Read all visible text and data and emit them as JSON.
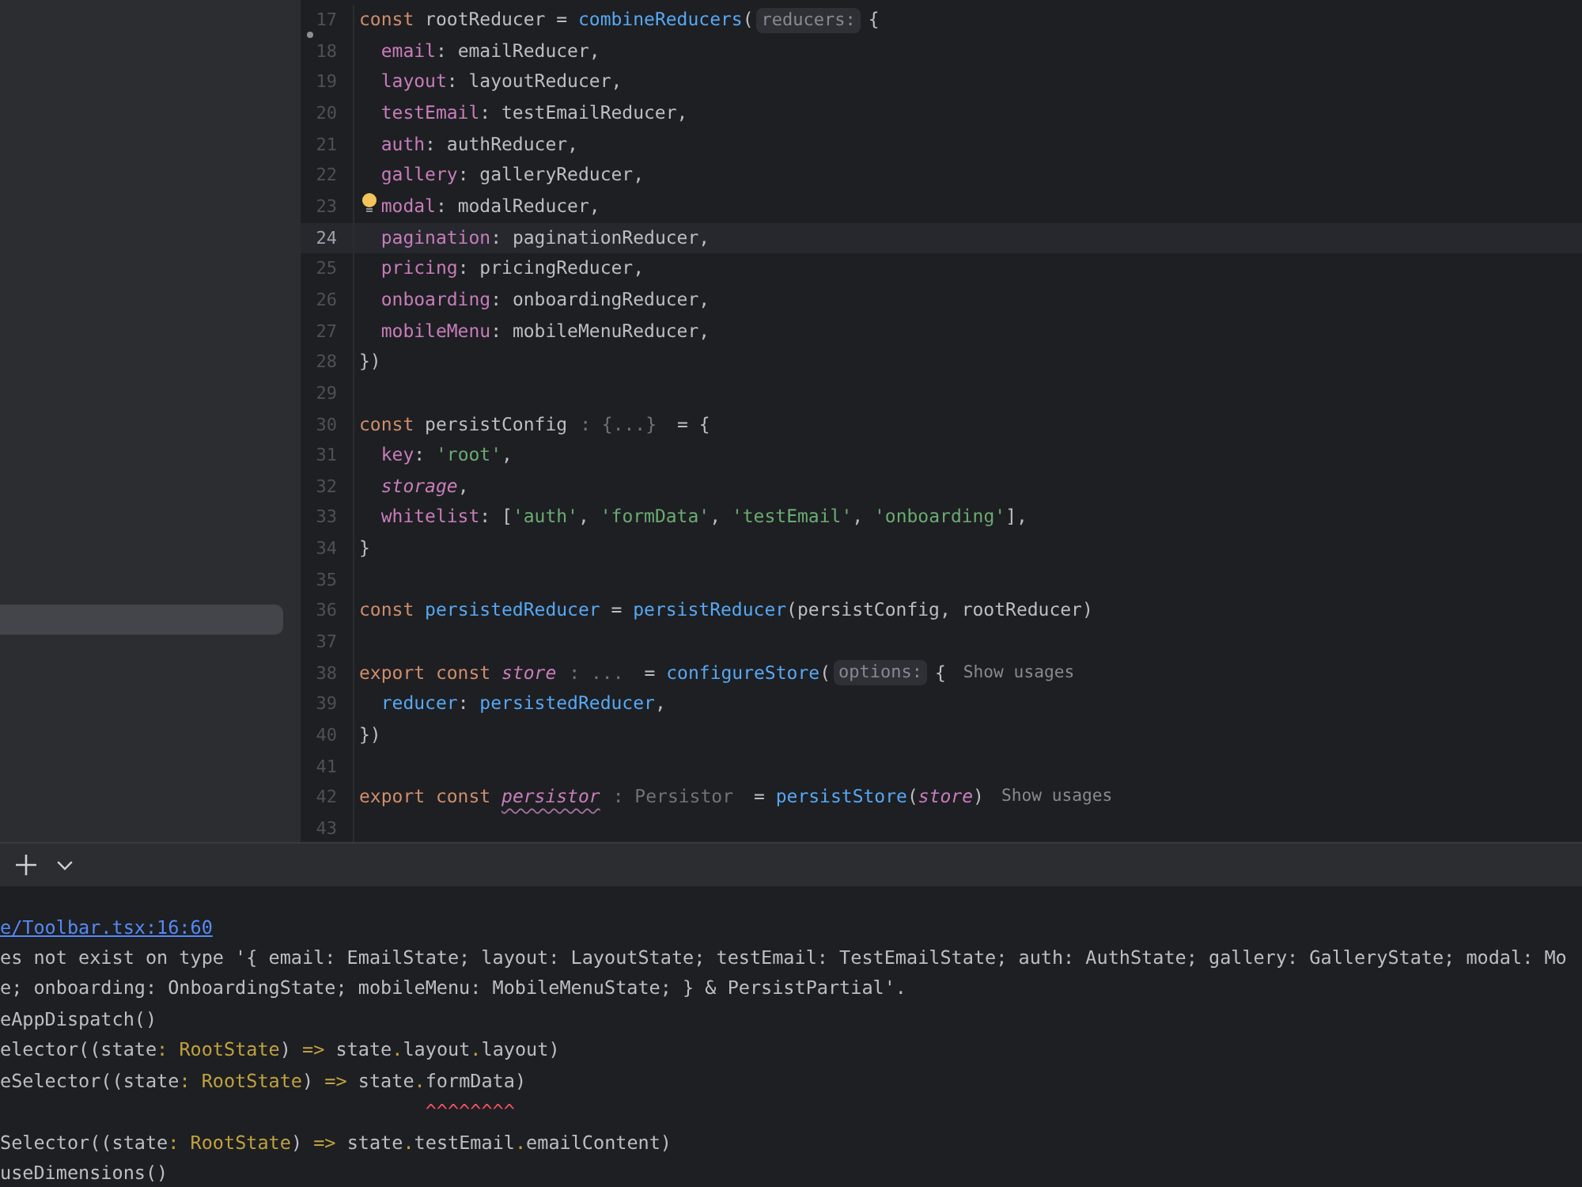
{
  "sidebar": {
    "rows": [
      {
        "selected": true
      }
    ]
  },
  "editor": {
    "lines": [
      {
        "number": "17",
        "current": false,
        "marked": true,
        "quick_fix": false,
        "tokens": [
          {
            "kind": "keyword",
            "text": "const"
          },
          {
            "kind": "text",
            "text": " rootReducer = "
          },
          {
            "kind": "call",
            "text": "combineReducers"
          },
          {
            "kind": "text",
            "text": "("
          },
          {
            "kind": "hint",
            "text": "reducers:"
          },
          {
            "kind": "text",
            "text": "{"
          }
        ],
        "children": [
          {
            "number": "18",
            "current": false,
            "marked": false,
            "quick_fix": false,
            "tokens": [
              {
                "kind": "property",
                "text": "email"
              },
              {
                "kind": "text",
                "text": ": emailReducer,"
              }
            ]
          },
          {
            "number": "19",
            "current": false,
            "marked": false,
            "quick_fix": false,
            "tokens": [
              {
                "kind": "property",
                "text": "layout"
              },
              {
                "kind": "text",
                "text": ": layoutReducer,"
              }
            ]
          },
          {
            "number": "20",
            "current": false,
            "marked": false,
            "quick_fix": false,
            "tokens": [
              {
                "kind": "property",
                "text": "testEmail"
              },
              {
                "kind": "text",
                "text": ": testEmailReducer,"
              }
            ]
          },
          {
            "number": "21",
            "current": false,
            "marked": false,
            "quick_fix": false,
            "tokens": [
              {
                "kind": "property",
                "text": "auth"
              },
              {
                "kind": "text",
                "text": ": authReducer,"
              }
            ]
          },
          {
            "number": "22",
            "current": false,
            "marked": false,
            "quick_fix": false,
            "tokens": [
              {
                "kind": "property",
                "text": "gallery"
              },
              {
                "kind": "text",
                "text": ": galleryReducer,"
              }
            ]
          },
          {
            "number": "23",
            "current": false,
            "marked": false,
            "quick_fix": true,
            "tokens": [
              {
                "kind": "property",
                "text": "modal"
              },
              {
                "kind": "text",
                "text": ": modalReducer,"
              }
            ]
          },
          {
            "number": "24",
            "current": true,
            "marked": false,
            "quick_fix": false,
            "tokens": [
              {
                "kind": "property",
                "text": "pagination"
              },
              {
                "kind": "text",
                "text": ": paginationReducer,"
              }
            ]
          },
          {
            "number": "25",
            "current": false,
            "marked": false,
            "quick_fix": false,
            "tokens": [
              {
                "kind": "property",
                "text": "pricing"
              },
              {
                "kind": "text",
                "text": ": pricingReducer,"
              }
            ]
          },
          {
            "number": "26",
            "current": false,
            "marked": false,
            "quick_fix": false,
            "tokens": [
              {
                "kind": "property",
                "text": "onboarding"
              },
              {
                "kind": "text",
                "text": ": onboardingReducer,"
              }
            ]
          },
          {
            "number": "27",
            "current": false,
            "marked": false,
            "quick_fix": false,
            "tokens": [
              {
                "kind": "property",
                "text": "mobileMenu"
              },
              {
                "kind": "text",
                "text": ": mobileMenuReducer,"
              }
            ]
          }
        ]
      },
      {
        "number": "28",
        "current": false,
        "marked": false,
        "quick_fix": false,
        "tokens": [
          {
            "kind": "text",
            "text": "})"
          }
        ]
      },
      {
        "number": "29",
        "current": false,
        "marked": false,
        "quick_fix": false
      },
      {
        "number": "30",
        "current": false,
        "marked": false,
        "quick_fix": false,
        "tokens": [
          {
            "kind": "keyword",
            "text": "const"
          },
          {
            "kind": "text",
            "text": " persistConfig"
          },
          {
            "kind": "type_hint",
            "text": ": {...}"
          },
          {
            "kind": "text",
            "text": "= {"
          }
        ],
        "children": [
          {
            "number": "31",
            "current": false,
            "marked": false,
            "quick_fix": false,
            "tokens": [
              {
                "kind": "property",
                "text": "key"
              },
              {
                "kind": "text",
                "text": ": "
              },
              {
                "kind": "string",
                "text": "'root'"
              },
              {
                "kind": "text",
                "text": ","
              }
            ]
          },
          {
            "number": "32",
            "current": false,
            "marked": false,
            "quick_fix": false,
            "tokens": [
              {
                "kind": "local",
                "text": "storage"
              },
              {
                "kind": "text",
                "text": ","
              }
            ]
          },
          {
            "number": "33",
            "current": false,
            "marked": false,
            "quick_fix": false,
            "tokens": [
              {
                "kind": "property",
                "text": "whitelist"
              },
              {
                "kind": "text",
                "text": ": ["
              },
              {
                "kind": "string",
                "text": "'auth'"
              },
              {
                "kind": "text",
                "text": ", "
              },
              {
                "kind": "string",
                "text": "'formData'"
              },
              {
                "kind": "text",
                "text": ", "
              },
              {
                "kind": "string",
                "text": "'testEmail'"
              },
              {
                "kind": "text",
                "text": ", "
              },
              {
                "kind": "string",
                "text": "'onboarding'"
              },
              {
                "kind": "text",
                "text": "],"
              }
            ]
          }
        ]
      },
      {
        "number": "34",
        "current": false,
        "marked": false,
        "quick_fix": false,
        "tokens": [
          {
            "kind": "text",
            "text": "}"
          }
        ]
      },
      {
        "number": "35",
        "current": false,
        "marked": false,
        "quick_fix": false
      },
      {
        "number": "36",
        "current": false,
        "marked": false,
        "quick_fix": false,
        "tokens": [
          {
            "kind": "keyword",
            "text": "const "
          },
          {
            "kind": "call",
            "text": "persistedReducer"
          },
          {
            "kind": "text",
            "text": " = "
          },
          {
            "kind": "call",
            "text": "persistReducer"
          },
          {
            "kind": "text",
            "text": "(persistConfig, rootReducer)"
          }
        ]
      },
      {
        "number": "37",
        "current": false,
        "marked": false,
        "quick_fix": false
      },
      {
        "number": "38",
        "current": false,
        "marked": false,
        "quick_fix": false,
        "tokens": [
          {
            "kind": "keyword",
            "text": "export const "
          },
          {
            "kind": "local",
            "text": "store"
          },
          {
            "kind": "type_hint",
            "text": ": ..."
          },
          {
            "kind": "text",
            "text": "= "
          },
          {
            "kind": "call",
            "text": "configureStore"
          },
          {
            "kind": "text",
            "text": "("
          },
          {
            "kind": "hint",
            "text": "options:"
          },
          {
            "kind": "text",
            "text": "{"
          },
          {
            "kind": "usages",
            "text": "Show usages"
          }
        ],
        "children": [
          {
            "number": "39",
            "current": false,
            "marked": false,
            "quick_fix": false,
            "tokens": [
              {
                "kind": "call",
                "text": "reducer"
              },
              {
                "kind": "text",
                "text": ": "
              },
              {
                "kind": "call",
                "text": "persistedReducer"
              },
              {
                "kind": "text",
                "text": ","
              }
            ]
          }
        ]
      },
      {
        "number": "40",
        "current": false,
        "marked": false,
        "quick_fix": false,
        "tokens": [
          {
            "kind": "text",
            "text": "})"
          }
        ]
      },
      {
        "number": "41",
        "current": false,
        "marked": false,
        "quick_fix": false
      },
      {
        "number": "42",
        "current": false,
        "marked": false,
        "quick_fix": false,
        "tokens": [
          {
            "kind": "keyword",
            "text": "export const "
          },
          {
            "kind": "local_flagged",
            "text": "persistor"
          },
          {
            "kind": "type_hint",
            "text": ": Persistor"
          },
          {
            "kind": "text",
            "text": "= "
          },
          {
            "kind": "call",
            "text": "persistStore"
          },
          {
            "kind": "text",
            "text": "("
          },
          {
            "kind": "local",
            "text": "store"
          },
          {
            "kind": "text",
            "text": ")"
          },
          {
            "kind": "usages",
            "text": "Show usages"
          }
        ]
      },
      {
        "number": "43",
        "current": false,
        "marked": false,
        "quick_fix": false
      }
    ]
  },
  "terminal": {
    "lines": [
      {
        "kind": "link",
        "text": "e/Toolbar.tsx:16:60"
      },
      {
        "kind": "output",
        "segments": [
          {
            "kind": "plain",
            "text": "es not exist on type '{ email: EmailState; layout: LayoutState; testEmail: TestEmailState; auth: AuthState; gallery: GalleryState; modal: Mo"
          }
        ]
      },
      {
        "kind": "output",
        "segments": [
          {
            "kind": "plain",
            "text": "e; onboarding: OnboardingState; mobileMenu: MobileMenuState; } & PersistPartial'."
          }
        ]
      },
      {
        "kind": "output",
        "segments": [
          {
            "kind": "plain",
            "text": "eAppDispatch()"
          }
        ]
      },
      {
        "kind": "output",
        "segments": [
          {
            "kind": "plain",
            "text": "elector((state"
          },
          {
            "kind": "type",
            "text": ": RootState"
          },
          {
            "kind": "plain",
            "text": ") "
          },
          {
            "kind": "type",
            "text": "=>"
          },
          {
            "kind": "plain",
            "text": " state"
          },
          {
            "kind": "type",
            "text": "."
          },
          {
            "kind": "plain",
            "text": "layout"
          },
          {
            "kind": "type",
            "text": "."
          },
          {
            "kind": "plain",
            "text": "layout)"
          }
        ]
      },
      {
        "kind": "output",
        "segments": [
          {
            "kind": "plain",
            "text": "eSelector((state"
          },
          {
            "kind": "type",
            "text": ": RootState"
          },
          {
            "kind": "plain",
            "text": ") "
          },
          {
            "kind": "type",
            "text": "=>"
          },
          {
            "kind": "plain",
            "text": " state"
          },
          {
            "kind": "type",
            "text": "."
          },
          {
            "kind": "plain",
            "text": "formData)"
          }
        ]
      },
      {
        "kind": "marker",
        "text": "                                      ^^^^^^^^"
      },
      {
        "kind": "output",
        "segments": [
          {
            "kind": "plain",
            "text": "Selector((state"
          },
          {
            "kind": "type",
            "text": ": RootState"
          },
          {
            "kind": "plain",
            "text": ") "
          },
          {
            "kind": "type",
            "text": "=>"
          },
          {
            "kind": "plain",
            "text": " state"
          },
          {
            "kind": "type",
            "text": "."
          },
          {
            "kind": "plain",
            "text": "testEmail"
          },
          {
            "kind": "type",
            "text": "."
          },
          {
            "kind": "plain",
            "text": "emailContent)"
          }
        ]
      },
      {
        "kind": "output",
        "segments": [
          {
            "kind": "plain",
            "text": "useDimensions()"
          }
        ]
      }
    ]
  }
}
